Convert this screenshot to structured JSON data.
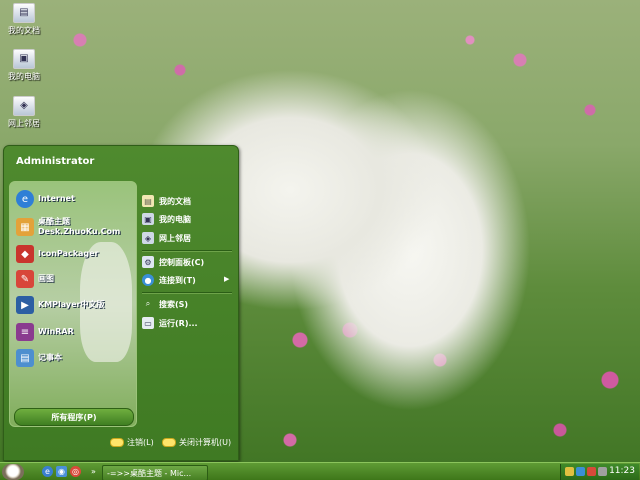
{
  "desktop_icons": [
    {
      "label": "我的文档",
      "icon": "my-documents-icon"
    },
    {
      "label": "我的电脑",
      "icon": "my-computer-icon"
    },
    {
      "label": "网上邻居",
      "icon": "network-places-icon"
    }
  ],
  "start_menu": {
    "user": "Administrator",
    "left_items": [
      {
        "label": "Internet",
        "icon": "internet-explorer-icon"
      },
      {
        "label": "桌酷主题",
        "label2": "Desk.ZhuoKu.Com",
        "icon": "theme-icon"
      },
      {
        "label": "IconPackager",
        "icon": "iconpackager-icon"
      },
      {
        "label": "画图",
        "icon": "paint-icon"
      },
      {
        "label": "KMPlayer中文版",
        "icon": "kmplayer-icon"
      },
      {
        "label": "WinRAR",
        "icon": "winrar-icon"
      },
      {
        "label": "记事本",
        "icon": "notepad-icon"
      }
    ],
    "all_programs": "所有程序(P)",
    "right_items": [
      {
        "label": "我的文档",
        "icon": "my-documents-icon"
      },
      {
        "label": "我的电脑",
        "icon": "my-computer-icon"
      },
      {
        "label": "网上邻居",
        "icon": "network-places-icon"
      },
      {
        "label": "控制面板(C)",
        "icon": "control-panel-icon"
      },
      {
        "label": "连接到(T)",
        "icon": "connect-icon"
      },
      {
        "label": "搜索(S)",
        "icon": "search-icon"
      },
      {
        "label": "运行(R)...",
        "icon": "run-icon"
      }
    ],
    "logoff": "注销(L)",
    "shutdown": "关闭计算机(U)"
  },
  "taskbar": {
    "task_label": "-=>>桌酷主题 - Mic...",
    "clock": "11:23"
  },
  "colors": {
    "taskbar": "#4a8526",
    "menu": "#477f28",
    "accent": "#ffe56a"
  }
}
